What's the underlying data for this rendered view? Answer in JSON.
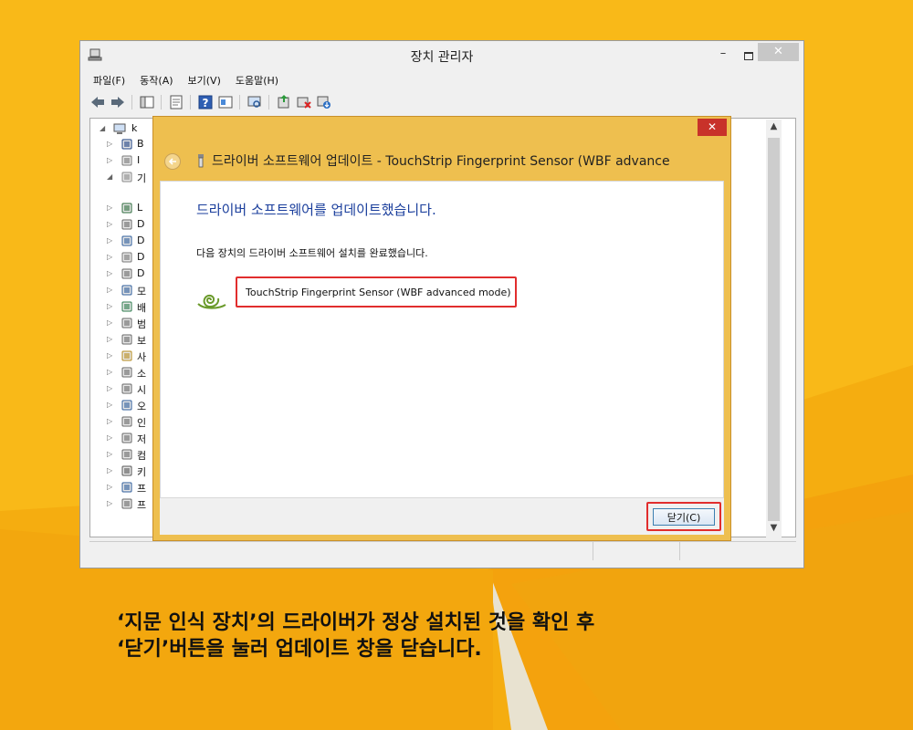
{
  "colors": {
    "background": "#f5ad10",
    "dialog_frame": "#eebf4f",
    "heading_blue": "#1a3e9c",
    "highlight_red": "#e12d2d",
    "close_red": "#c8322a"
  },
  "device_manager": {
    "title": "장치 관리자",
    "caption_buttons": {
      "minimize": "–",
      "close": "✕"
    },
    "menu": [
      "파일(F)",
      "동작(A)",
      "보기(V)",
      "도움말(H)"
    ],
    "toolbar_icons": [
      "back-arrow-icon",
      "forward-arrow-icon",
      "show-hide-tree-icon",
      "properties-icon",
      "help-icon",
      "view-icon",
      "scan-hardware-icon",
      "update-driver-icon",
      "disable-device-icon",
      "uninstall-device-icon"
    ],
    "tree": {
      "root_label": "k",
      "partial_labels": [
        "B",
        "I",
        "기",
        "",
        "L",
        "D",
        "D",
        "D",
        "D",
        "모",
        "배",
        "범",
        "보",
        "사",
        "소",
        "시",
        "오",
        "인",
        "저",
        "컴",
        "키",
        "프",
        "프"
      ],
      "icons": [
        "computer-icon",
        "bluetooth-icon",
        "drive-icon",
        "fingerprint-device-icon",
        "usb-device-icon",
        "network-icon",
        "disk-icon",
        "display-icon",
        "mouse-icon",
        "keyboard-icon",
        "monitor-icon",
        "network-adapter-icon",
        "battery-icon",
        "port-icon",
        "security-device-icon",
        "sound-icon",
        "storage-icon",
        "system-icon",
        "sound-icon",
        "camera-icon",
        "print-queue-icon",
        "software-icon",
        "computer-icon",
        "keyboard-icon",
        "processor-icon",
        "processor-icon"
      ]
    },
    "scroll": {
      "up": "▲",
      "down": "▼"
    }
  },
  "dialog": {
    "close_glyph": "✕",
    "title": "드라이버 소프트웨어 업데이트 - TouchStrip Fingerprint Sensor (WBF advance",
    "success_heading": "드라이버 소프트웨어를 업데이트했습니다.",
    "complete_message": "다음 장치의 드라이버 소프트웨어 설치를 완료했습니다.",
    "device_name": "TouchStrip Fingerprint Sensor (WBF advanced mode)",
    "close_button_label": "닫기(C)"
  },
  "caption": {
    "line1": "‘지문 인식 장치’의 드라이버가 정상 설치된 것을 확인 후",
    "line2": "‘닫기’버튼을 눌러 업데이트 창을 닫습니다."
  }
}
